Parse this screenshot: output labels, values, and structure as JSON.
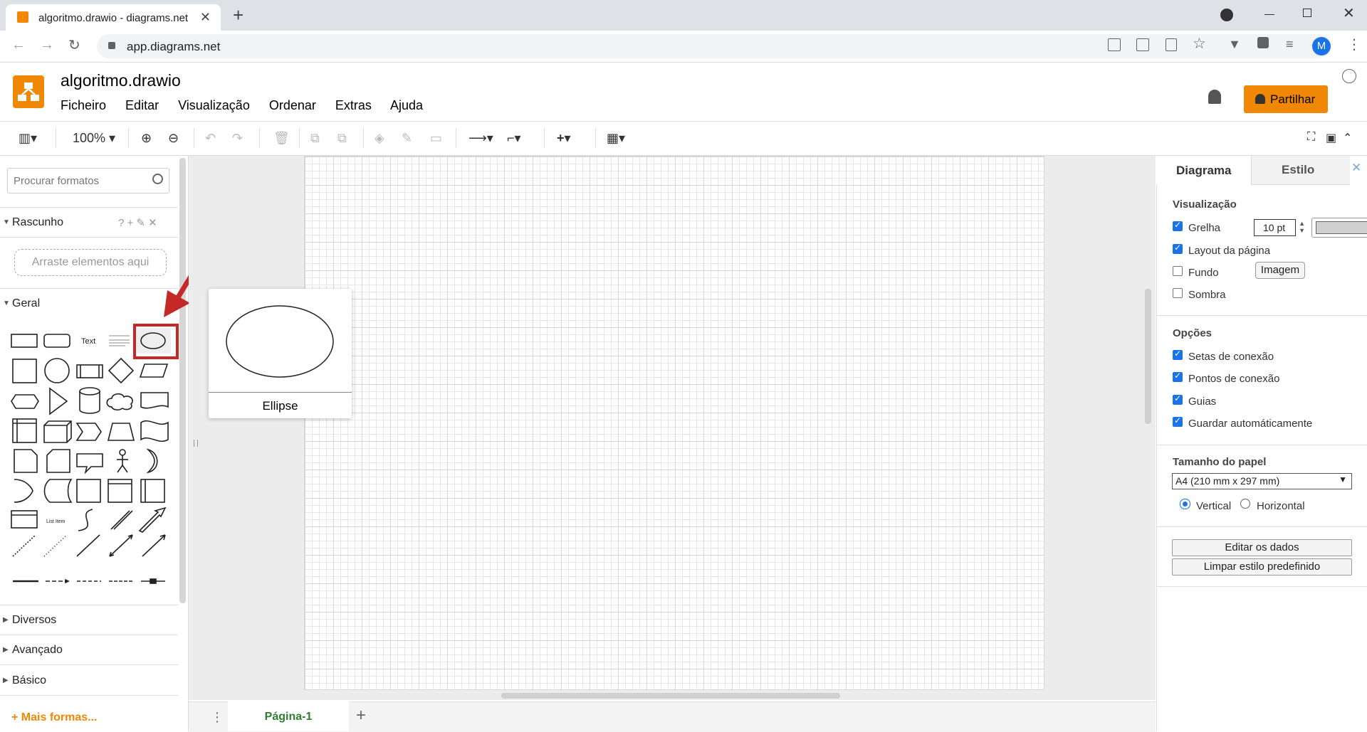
{
  "browser": {
    "tab_title": "algoritmo.drawio - diagrams.net",
    "url": "app.diagrams.net",
    "profile_initial": "M"
  },
  "app": {
    "filename": "algoritmo.drawio",
    "menu": [
      "Ficheiro",
      "Editar",
      "Visualização",
      "Ordenar",
      "Extras",
      "Ajuda"
    ],
    "share_label": "Partilhar",
    "zoom": "100%"
  },
  "sidebar": {
    "search_placeholder": "Procurar formatos",
    "scratch_title": "Rascunho",
    "scratch_drop": "Arraste elementos aqui",
    "general_title": "Geral",
    "text_shape_label": "Text",
    "list_item_label": "List Item",
    "sections": [
      "Diversos",
      "Avançado",
      "Básico"
    ],
    "more_shapes": "Mais formas..."
  },
  "preview": {
    "label": "Ellipse"
  },
  "pages": {
    "current": "Página-1"
  },
  "right_panel": {
    "tabs": [
      "Diagrama",
      "Estilo"
    ],
    "view_heading": "Visualização",
    "grid_label": "Grelha",
    "grid_size": "10 pt",
    "page_layout_label": "Layout da página",
    "background_label": "Fundo",
    "image_button": "Imagem",
    "shadow_label": "Sombra",
    "options_heading": "Opções",
    "options": [
      "Setas de conexão",
      "Pontos de conexão",
      "Guias",
      "Guardar automáticamente"
    ],
    "paper_heading": "Tamanho do papel",
    "paper_size": "A4 (210 mm x 297 mm)",
    "orientation": [
      "Vertical",
      "Horizontal"
    ],
    "edit_data_button": "Editar os dados",
    "clear_style_button": "Limpar estilo predefinido"
  },
  "colors": {
    "brand": "#f08705",
    "highlight": "#c62828",
    "page_tab_text": "#2e7d32"
  }
}
